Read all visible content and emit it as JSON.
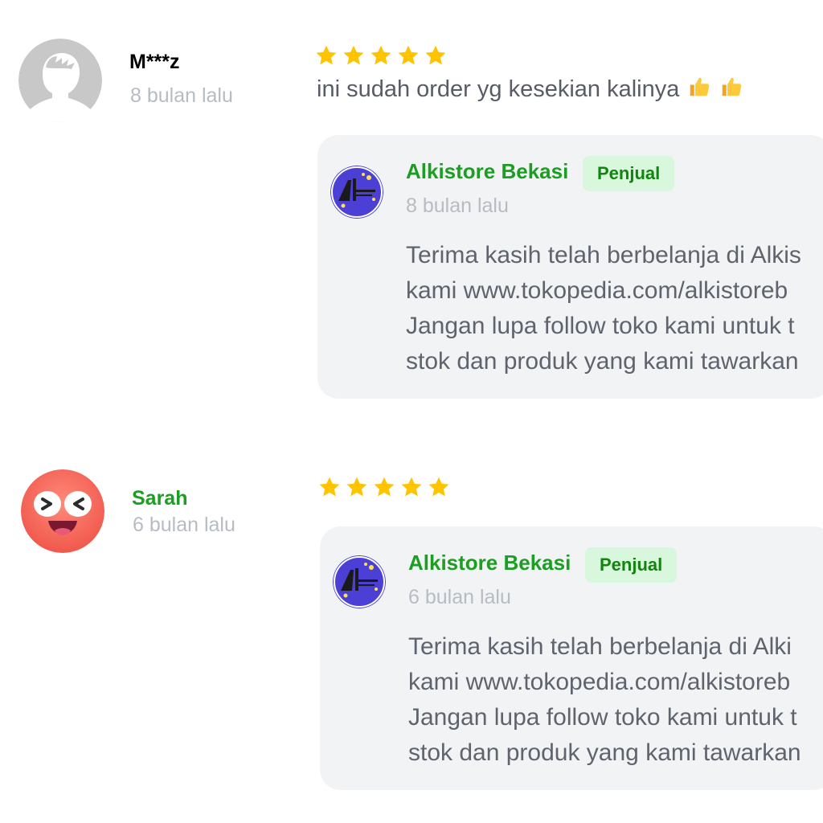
{
  "colors": {
    "accent_green": "#1b9e22",
    "badge_bg": "#d9f7dc",
    "badge_text": "#12850e",
    "star": "#ffc400",
    "name_dark": "#2a2d33",
    "muted": "#b7bcc4",
    "reply_bg": "#f2f3f5",
    "seller_avatar_bg": "#4b3fd6"
  },
  "reviews": [
    {
      "reviewer": {
        "name": "M***z",
        "time": "8 bulan lalu",
        "avatar_icon": "default-user-avatar-icon",
        "name_color": "#2a2d33"
      },
      "rating": 5,
      "text": "ini sudah order yg kesekian kalinya",
      "emoji": [
        "thumbs-up-icon",
        "thumbs-up-icon"
      ],
      "reply": {
        "seller_name": "Alkistore Bekasi",
        "badge": "Penjual",
        "time": "8 bulan lalu",
        "avatar_icon": "alkistore-logo-icon",
        "lines": [
          "Terima kasih telah berbelanja di Alkis",
          "kami www.tokopedia.com/alkistoreb",
          "Jangan lupa follow toko kami untuk t",
          "stok dan produk yang kami tawarkan"
        ]
      }
    },
    {
      "reviewer": {
        "name": "Sarah",
        "time": "6 bulan lalu",
        "avatar_icon": "laughing-face-avatar-icon",
        "name_color": "#1b9e22"
      },
      "rating": 5,
      "text": "",
      "emoji": [],
      "reply": {
        "seller_name": "Alkistore Bekasi",
        "badge": "Penjual",
        "time": "6 bulan lalu",
        "avatar_icon": "alkistore-logo-icon",
        "lines": [
          "Terima kasih telah berbelanja di Alki",
          "kami www.tokopedia.com/alkistoreb",
          "Jangan lupa follow toko kami untuk t",
          "stok dan produk yang kami tawarkan"
        ]
      }
    }
  ]
}
